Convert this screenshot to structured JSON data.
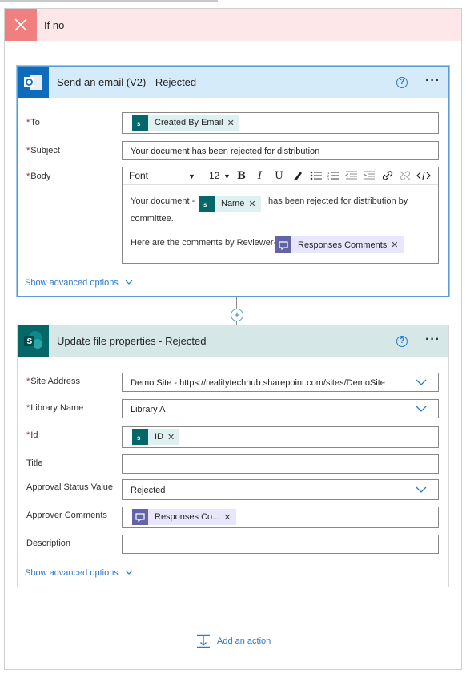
{
  "condition": {
    "title": "If no"
  },
  "email_card": {
    "title": "Send an email (V2) - Rejected",
    "fields": {
      "to_label": "To",
      "to_token": "Created By Email",
      "subject_label": "Subject",
      "subject_value": "Your document has been rejected for distribution",
      "body_label": "Body"
    },
    "toolbar": {
      "font": "Font",
      "size": "12",
      "bold": "B",
      "italic": "I",
      "underline": "U"
    },
    "body": {
      "line1_prefix": "Your document -",
      "name_token": "Name",
      "line1_suffix": "has been rejected for distribution by",
      "line2": "committee.",
      "line3_prefix": "Here are the comments by Reviewer-",
      "comments_token": "Responses Comments"
    },
    "advanced": "Show advanced options"
  },
  "update_card": {
    "title": "Update file properties - Rejected",
    "fields": {
      "site_label": "Site Address",
      "site_value": "Demo Site - https://realitytechhub.sharepoint.com/sites/DemoSite",
      "library_label": "Library Name",
      "library_value": "Library A",
      "id_label": "Id",
      "id_token": "ID",
      "title_label": "Title",
      "approval_label": "Approval Status Value",
      "approval_value": "Rejected",
      "approver_label": "Approver Comments",
      "approver_token": "Responses Co...",
      "description_label": "Description"
    },
    "advanced": "Show advanced options"
  },
  "add_action": "Add an action",
  "colors": {
    "accent": "#2b79c7",
    "outlook": "#0f6cbd",
    "sharepoint": "#056768",
    "forms": "#6264a7",
    "no_branch": "#fde7e9"
  },
  "icons": [
    "close-icon",
    "outlook-icon",
    "sharepoint-icon",
    "forms-icon",
    "help-icon",
    "more-icon",
    "chevron-down-icon",
    "plus-icon",
    "add-action-icon"
  ]
}
